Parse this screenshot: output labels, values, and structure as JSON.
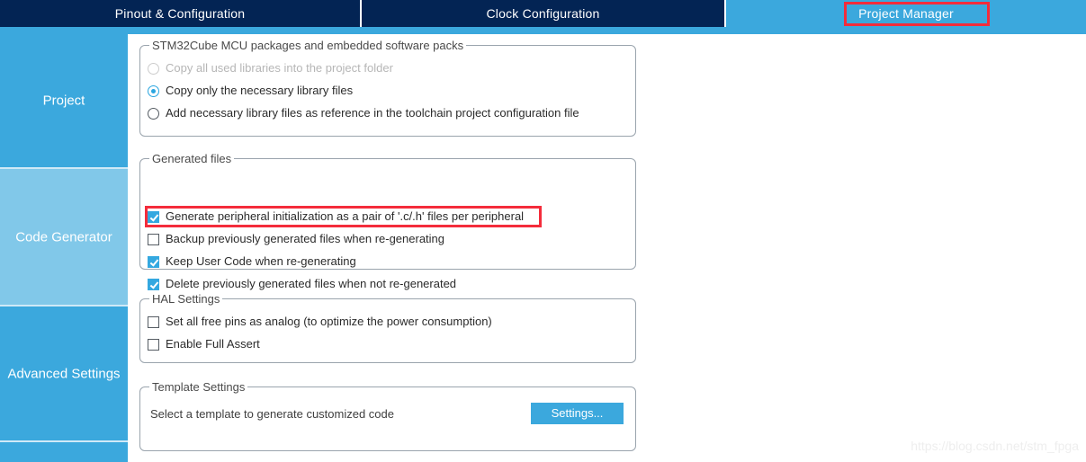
{
  "colors": {
    "tab_inactive_bg": "#032454",
    "tab_active_bg": "#3ba8dd",
    "sidebar_bg": "#3ba8dd",
    "sidebar_selected_bg": "#81c8e9",
    "accent": "#34a8e0",
    "annotation_red": "#f42c3b",
    "group_border": "#9aa4ad",
    "disabled_text": "#b6b6b6"
  },
  "tabs": [
    {
      "id": "pinout",
      "label": "Pinout & Configuration",
      "active": false
    },
    {
      "id": "clock",
      "label": "Clock Configuration",
      "active": false
    },
    {
      "id": "project",
      "label": "Project Manager",
      "active": true
    }
  ],
  "sidebar": {
    "items": [
      {
        "id": "project",
        "label": "Project",
        "selected": false
      },
      {
        "id": "codegen",
        "label": "Code Generator",
        "selected": true
      },
      {
        "id": "advanced",
        "label": "Advanced Settings",
        "selected": false
      }
    ]
  },
  "groups": {
    "packages": {
      "title": "STM32Cube MCU packages and embedded software packs",
      "options": [
        {
          "label": "Copy all used libraries into the project folder",
          "selected": false,
          "disabled": true
        },
        {
          "label": "Copy only the necessary library files",
          "selected": true,
          "disabled": false
        },
        {
          "label": "Add necessary library files as reference in the toolchain project configuration file",
          "selected": false,
          "disabled": false
        }
      ]
    },
    "generated_files": {
      "title": "Generated files",
      "options": [
        {
          "label": "Generate peripheral initialization as a pair of '.c/.h' files per peripheral",
          "checked": true,
          "highlighted": true
        },
        {
          "label": "Backup previously generated files when re-generating",
          "checked": false,
          "highlighted": false
        },
        {
          "label": "Keep User Code when re-generating",
          "checked": true,
          "highlighted": false
        },
        {
          "label": "Delete previously generated files when not re-generated",
          "checked": true,
          "highlighted": false
        }
      ]
    },
    "hal_settings": {
      "title": "HAL Settings",
      "options": [
        {
          "label": "Set all free pins as analog (to optimize the power consumption)",
          "checked": false
        },
        {
          "label": "Enable Full Assert",
          "checked": false
        }
      ]
    },
    "template_settings": {
      "title": "Template Settings",
      "description": "Select a template to generate customized code",
      "button_label": "Settings..."
    }
  },
  "watermark": "https://blog.csdn.net/stm_fpga"
}
